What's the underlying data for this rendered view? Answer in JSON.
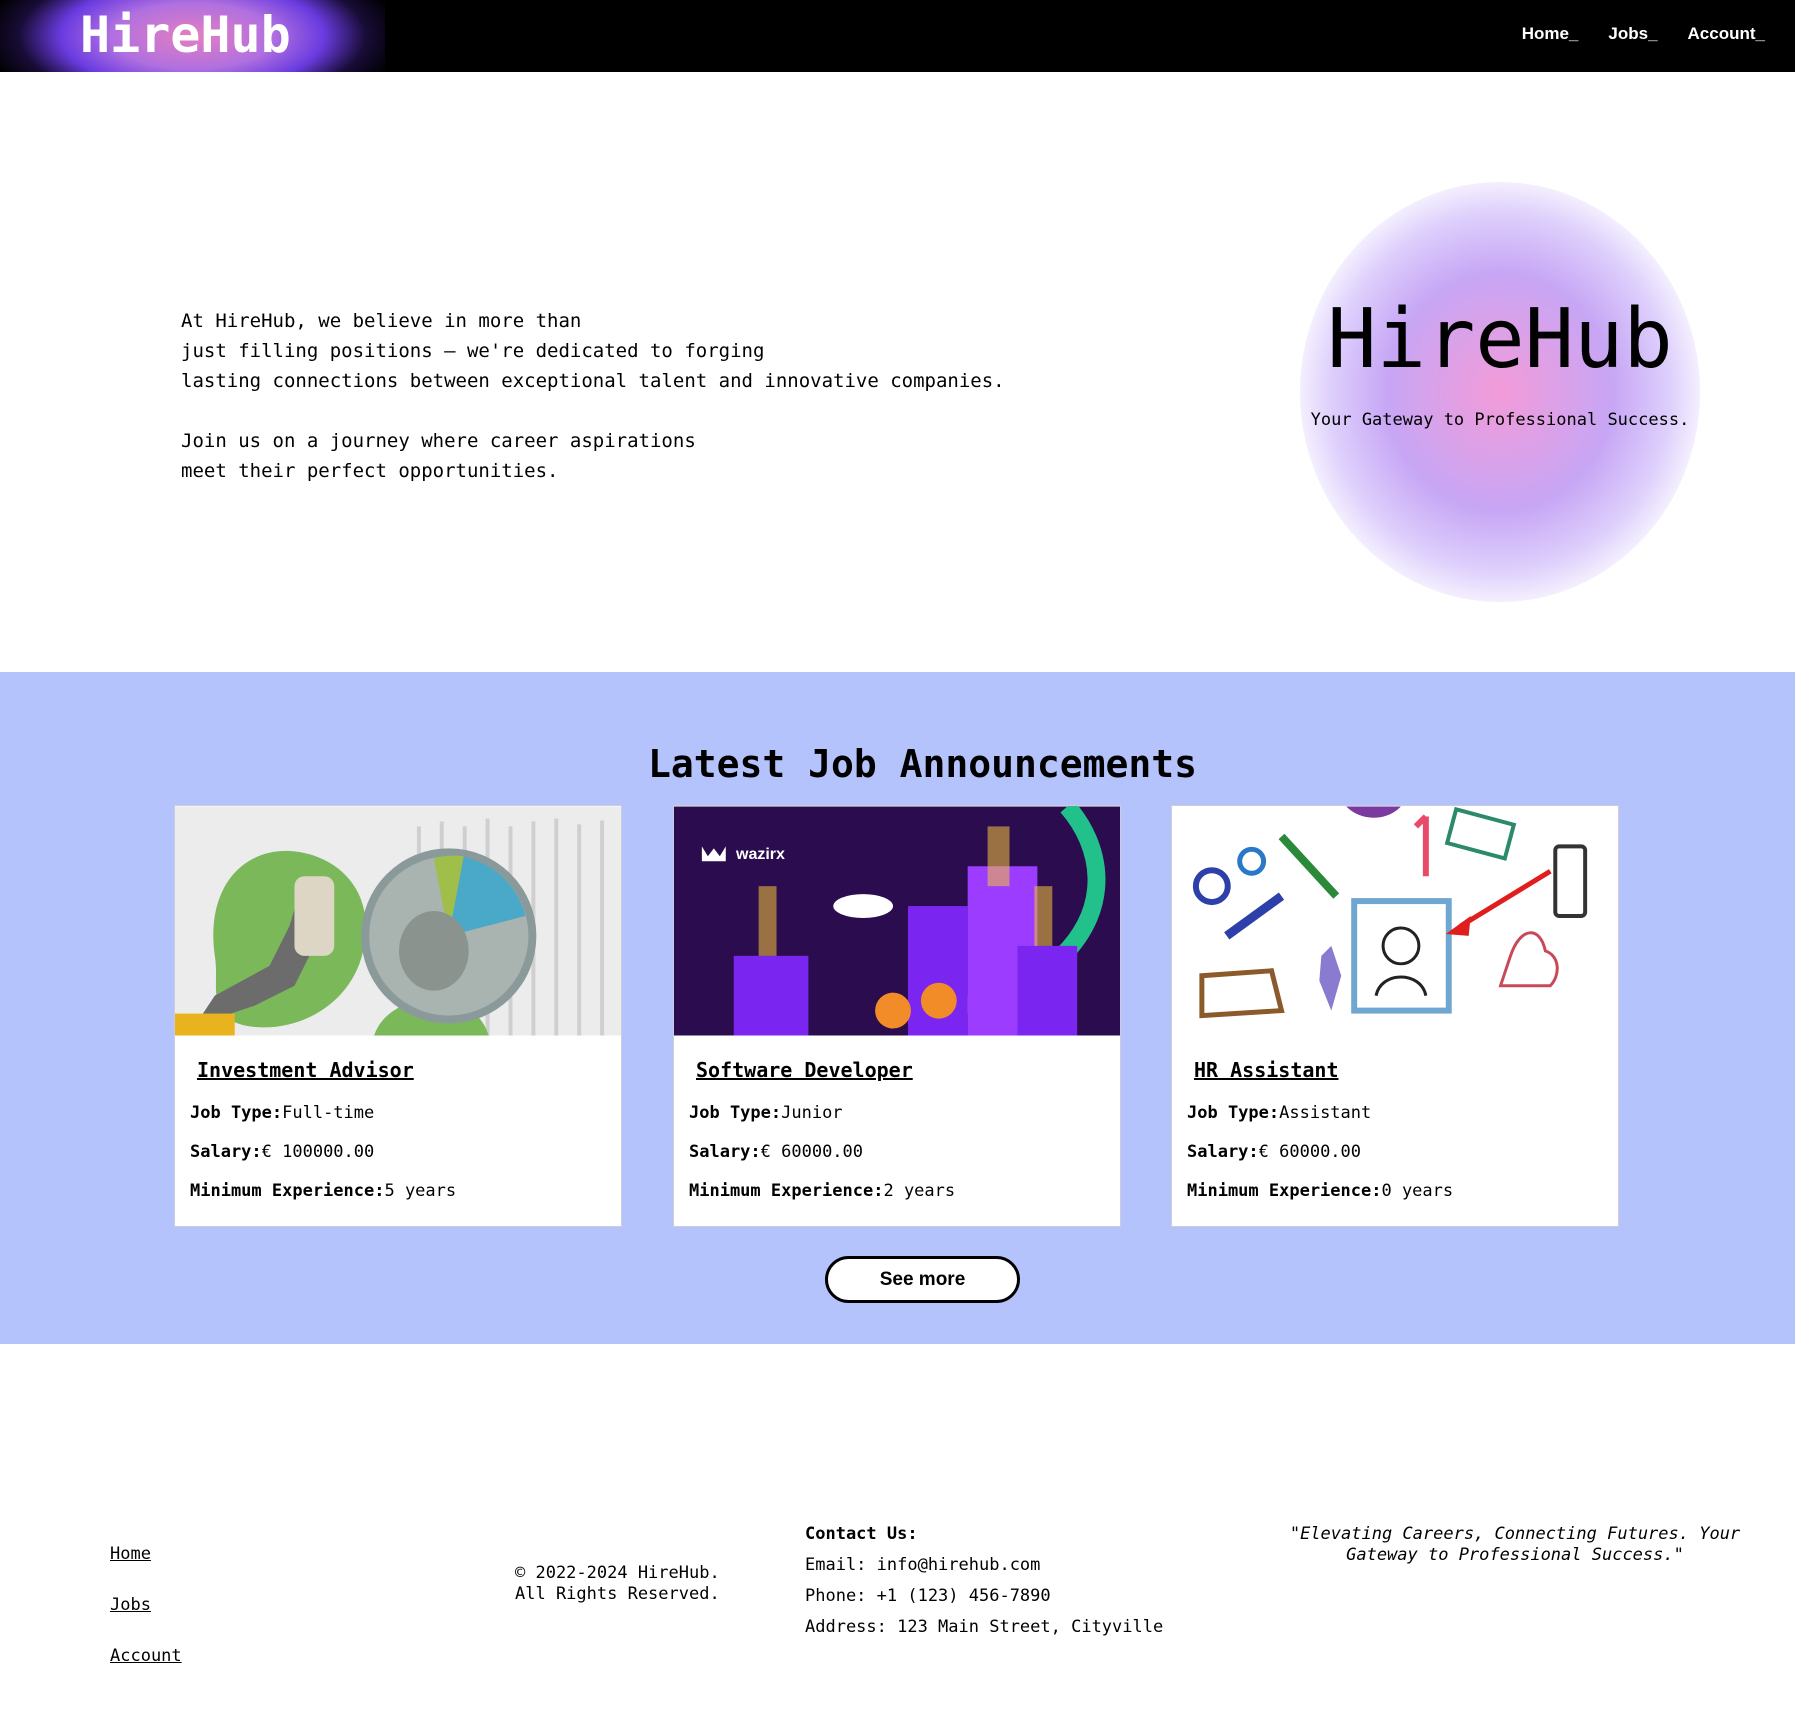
{
  "nav": {
    "logo": "HireHub",
    "links": [
      "Home_",
      "Jobs_",
      "Account_"
    ]
  },
  "hero": {
    "text": "At HireHub, we believe in more than\njust filling positions – we're dedicated to forging\nlasting connections between exceptional talent and innovative companies.\n\nJoin us on a journey where career aspirations\nmeet their perfect opportunities.",
    "title": "HireHub",
    "subtitle": "Your Gateway to Professional Success."
  },
  "jobs": {
    "heading": "Latest Job Announcements",
    "labels": {
      "type": "Job Type:",
      "salary": "Salary:",
      "experience": "Minimum Experience:"
    },
    "cards": [
      {
        "title": "Investment Advisor",
        "type": "Full-time",
        "salary": "€ 100000.00",
        "experience": "5 years",
        "image": "finance-collage"
      },
      {
        "title": "Software Developer",
        "type": "Junior",
        "salary": "€ 60000.00",
        "experience": "2 years",
        "image": "wazirx-crypto-illustration",
        "image_text": "wazirx"
      },
      {
        "title": "HR Assistant",
        "type": "Assistant",
        "salary": "€ 60000.00",
        "experience": "0 years",
        "image": "hr-doodle-illustration"
      }
    ],
    "see_more": "See more"
  },
  "footer": {
    "links": [
      "Home",
      "Jobs",
      "Account"
    ],
    "copyright": "© 2022-2024 HireHub.\nAll Rights Reserved.",
    "contact": {
      "heading": "Contact Us:",
      "email": "Email: info@hirehub.com",
      "phone": "Phone: +1 (123) 456-7890",
      "address": "Address: 123 Main Street, Cityville"
    },
    "quote": "\"Elevating Careers, Connecting Futures. Your Gateway to Professional Success.\""
  },
  "colors": {
    "nav_bg": "#000000",
    "jobs_bg": "#b5c3fd",
    "glow_pink": "#f39bd8",
    "glow_purple": "#c7a6f5"
  }
}
